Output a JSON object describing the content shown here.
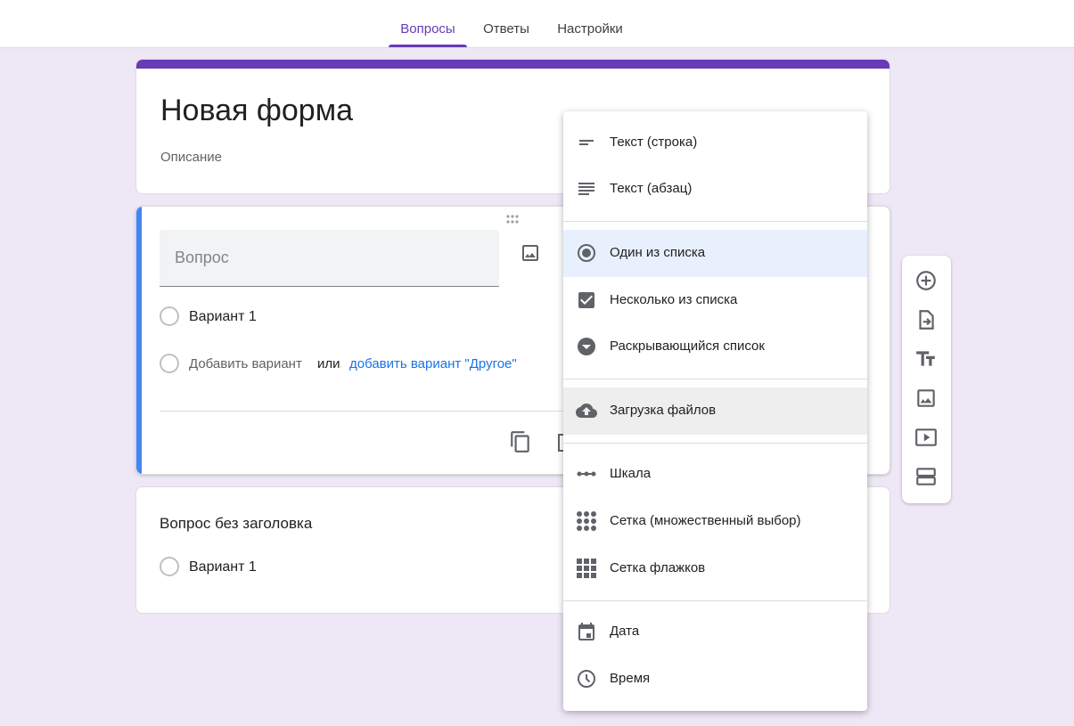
{
  "tabs": [
    {
      "label": "Вопросы",
      "active": true
    },
    {
      "label": "Ответы",
      "active": false
    },
    {
      "label": "Настройки",
      "active": false
    }
  ],
  "form": {
    "title": "Новая форма",
    "description": "Описание"
  },
  "question1": {
    "placeholder": "Вопрос",
    "option1": "Вариант 1",
    "add_option": "Добавить вариант",
    "or": "или",
    "add_other": "добавить вариант \"Другое\""
  },
  "question2": {
    "title": "Вопрос без заголовка",
    "option1": "Вариант 1"
  },
  "type_menu": {
    "items": [
      {
        "label": "Текст (строка)",
        "icon": "short-answer-icon"
      },
      {
        "label": "Текст (абзац)",
        "icon": "paragraph-icon"
      },
      {
        "label": "Один из списка",
        "icon": "radio-button-icon",
        "selected": true
      },
      {
        "label": "Несколько из списка",
        "icon": "checkbox-icon"
      },
      {
        "label": "Раскрывающийся список",
        "icon": "dropdown-icon"
      },
      {
        "label": "Загрузка файлов",
        "icon": "cloud-upload-icon",
        "highlighted": true
      },
      {
        "label": "Шкала",
        "icon": "linear-scale-icon"
      },
      {
        "label": "Сетка (множественный выбор)",
        "icon": "multiple-choice-grid-icon"
      },
      {
        "label": "Сетка флажков",
        "icon": "checkbox-grid-icon"
      },
      {
        "label": "Дата",
        "icon": "calendar-icon"
      },
      {
        "label": "Время",
        "icon": "clock-icon"
      }
    ]
  },
  "side_toolbar": [
    "add-question-icon",
    "import-questions-icon",
    "add-title-icon",
    "add-image-icon",
    "add-video-icon",
    "add-section-icon"
  ],
  "colors": {
    "accent": "#673ab7",
    "focus_border": "#4285f4",
    "link": "#1a73e8",
    "background": "#ede7f6",
    "icon": "#5f6368"
  }
}
